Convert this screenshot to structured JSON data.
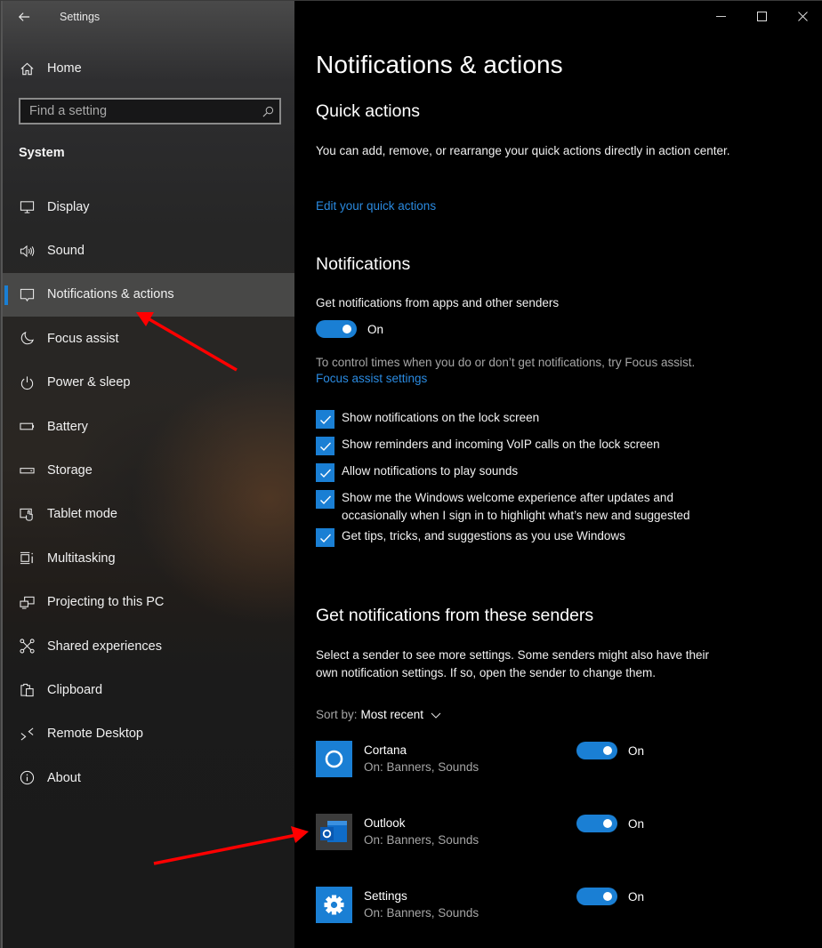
{
  "window": {
    "app_title": "Settings",
    "caption": {
      "minimize": "minimize",
      "maximize": "maximize",
      "close": "close"
    }
  },
  "sidebar": {
    "home_label": "Home",
    "search": {
      "placeholder": "Find a setting",
      "value": ""
    },
    "section_title": "System",
    "items": [
      {
        "label": "Display",
        "icon": "monitor-icon",
        "selected": false
      },
      {
        "label": "Sound",
        "icon": "speaker-icon",
        "selected": false
      },
      {
        "label": "Notifications & actions",
        "icon": "message-icon",
        "selected": true
      },
      {
        "label": "Focus assist",
        "icon": "moon-icon",
        "selected": false
      },
      {
        "label": "Power & sleep",
        "icon": "power-icon",
        "selected": false
      },
      {
        "label": "Battery",
        "icon": "battery-icon",
        "selected": false
      },
      {
        "label": "Storage",
        "icon": "storage-icon",
        "selected": false
      },
      {
        "label": "Tablet mode",
        "icon": "tablet-icon",
        "selected": false
      },
      {
        "label": "Multitasking",
        "icon": "multitasking-icon",
        "selected": false
      },
      {
        "label": "Projecting to this PC",
        "icon": "projecting-icon",
        "selected": false
      },
      {
        "label": "Shared experiences",
        "icon": "shared-icon",
        "selected": false
      },
      {
        "label": "Clipboard",
        "icon": "clipboard-icon",
        "selected": false
      },
      {
        "label": "Remote Desktop",
        "icon": "remote-icon",
        "selected": false
      },
      {
        "label": "About",
        "icon": "info-icon",
        "selected": false
      }
    ]
  },
  "main": {
    "page_title": "Notifications & actions",
    "quick_actions": {
      "heading": "Quick actions",
      "description": "You can add, remove, or rearrange your quick actions directly in action center.",
      "link": "Edit your quick actions"
    },
    "notifications": {
      "heading": "Notifications",
      "toggle_caption": "Get notifications from apps and other senders",
      "toggle_state": "On",
      "toggle_on": true,
      "focus_hint": "To control times when you do or don’t get notifications, try Focus assist.",
      "focus_link": "Focus assist settings",
      "checkboxes": [
        {
          "label": "Show notifications on the lock screen",
          "checked": true
        },
        {
          "label": "Show reminders and incoming VoIP calls on the lock screen",
          "checked": true
        },
        {
          "label": "Allow notifications to play sounds",
          "checked": true
        },
        {
          "label": "Show me the Windows welcome experience after updates and occasionally when I sign in to highlight what’s new and suggested",
          "checked": true
        },
        {
          "label": "Get tips, tricks, and suggestions as you use Windows",
          "checked": true
        }
      ]
    },
    "senders": {
      "heading": "Get notifications from these senders",
      "description": "Select a sender to see more settings. Some senders might also have their own notification settings. If so, open the sender to change them.",
      "sort_label": "Sort by:",
      "sort_value": "Most recent",
      "list": [
        {
          "name": "Cortana",
          "detail": "On: Banners, Sounds",
          "state": "On",
          "on": true,
          "icon": "cortana-icon"
        },
        {
          "name": "Outlook",
          "detail": "On: Banners, Sounds",
          "state": "On",
          "on": true,
          "icon": "outlook-icon"
        },
        {
          "name": "Settings",
          "detail": "On: Banners, Sounds",
          "state": "On",
          "on": true,
          "icon": "settings-gear-icon"
        }
      ]
    }
  },
  "colors": {
    "accent": "#1a7fd4",
    "link": "#2a8ae0",
    "annotation_arrow": "#ff0000"
  }
}
